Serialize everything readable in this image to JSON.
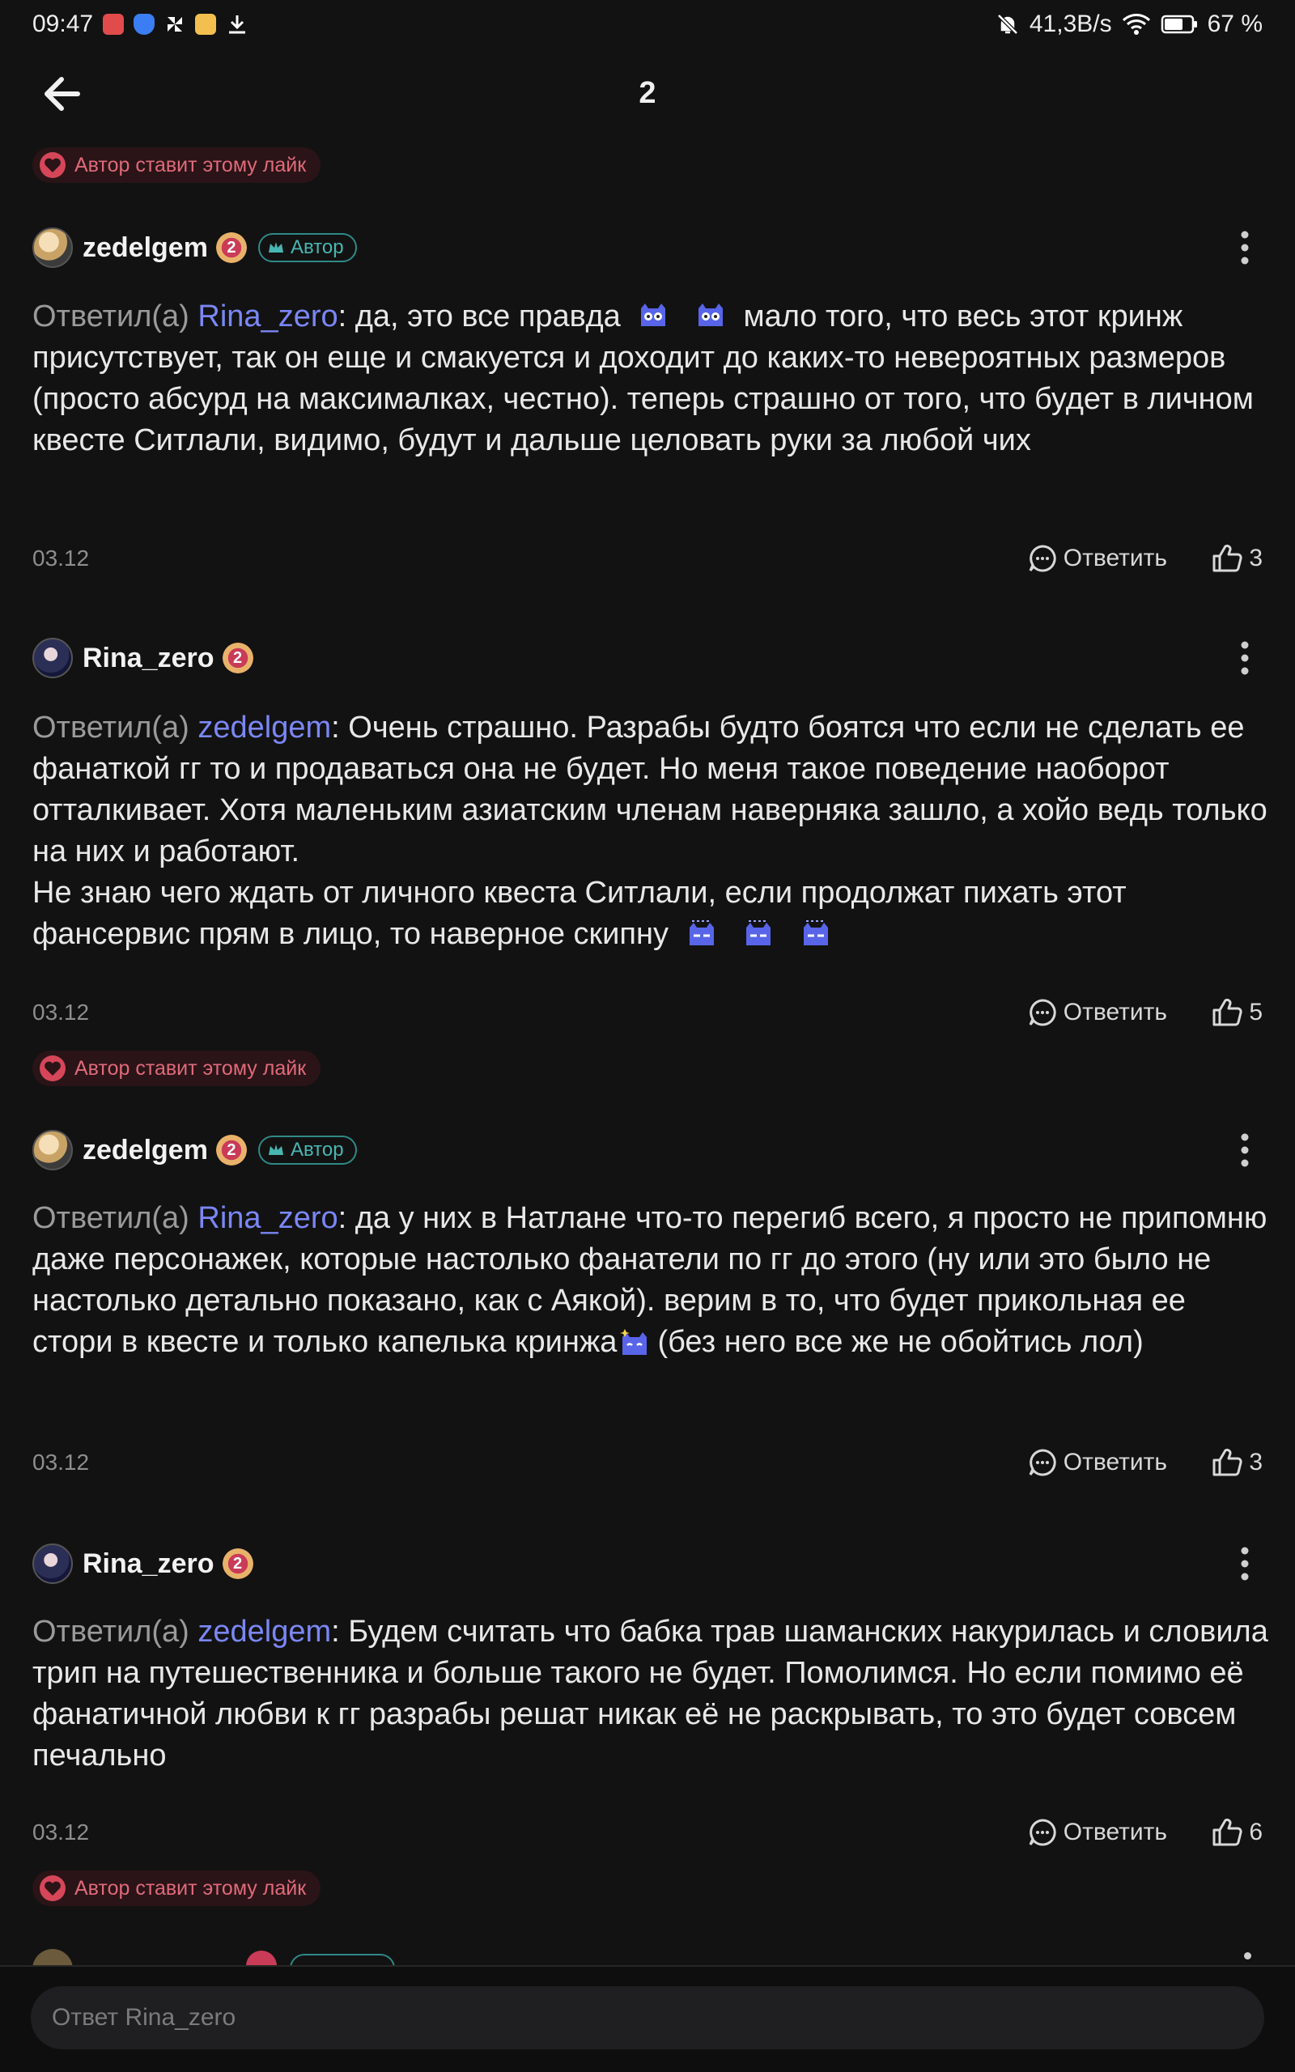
{
  "status": {
    "time": "09:47",
    "speed": "41,3B/s",
    "battery": "67 %"
  },
  "header": {
    "title": "2"
  },
  "liked_badge_text": "Автор ставит этому лайк",
  "author_tag": "Автор",
  "reply_label": "Ответить",
  "replied_prefix": "Ответил(а)",
  "comments": [
    {
      "user": "zedelgem",
      "level": "2",
      "mention": "Rina_zero",
      "text_a": ": да, это все правда",
      "text_b": "мало того, что весь этот кринж присутствует, так он еще и смакуется и доходит до каких-то невероятных размеров (просто абсурд на максималках, честно). теперь страшно от того, что будет в личном квесте Ситлали, видимо, будут и дальше целовать руки за любой чих",
      "date": "03.12",
      "likes": "3"
    },
    {
      "user": "Rina_zero",
      "level": "2",
      "mention": "zedelgem",
      "text_a": ": Очень страшно. Разрабы будто боятся что если не сделать ее фанаткой гг то и продаваться она не будет.  Но меня такое поведение наоборот отталкивает. Хотя маленьким азиатским членам наверняка зашло, а хойо ведь только на них и работают.",
      "text_b": "Не знаю чего ждать от личного квеста Ситлали, если продолжат пихать этот фансервис прям в лицо, то наверное скипну",
      "date": "03.12",
      "likes": "5"
    },
    {
      "user": "zedelgem",
      "level": "2",
      "mention": "Rina_zero",
      "text_a": ": да у них в Натлане что-то перегиб всего, я просто не припомню даже персонажек, которые настолько фанатели по гг до этого (ну или это было не настолько детально показано, как с Аякой). верим в то, что будет прикольная ее стори в квесте и только капелька кринжа",
      "text_b": "(без него все же не обойтись лол)",
      "date": "03.12",
      "likes": "3"
    },
    {
      "user": "Rina_zero",
      "level": "2",
      "mention": "zedelgem",
      "text_a": ": Будем считать что бабка трав шаманских накурилась и словила трип на путешественника и больше такого не будет. Помолимся. Но если помимо её фанатичной любви к гг разрабы решат никак её не раскрывать, то это будет совсем печально",
      "date": "03.12",
      "likes": "6"
    }
  ],
  "input": {
    "placeholder": "Ответ Rina_zero"
  },
  "colors": {
    "background": "#121212",
    "mention": "#7b87f5",
    "liked_badge": "#e06a7a",
    "author_tag": "#48b6b1"
  },
  "icons": [
    "back-arrow-icon",
    "more-vertical-icon",
    "comment-icon",
    "thumb-up-icon",
    "heart-badge-icon",
    "crown-icon",
    "bell-off-icon",
    "wifi-icon",
    "battery-icon",
    "download-icon"
  ]
}
